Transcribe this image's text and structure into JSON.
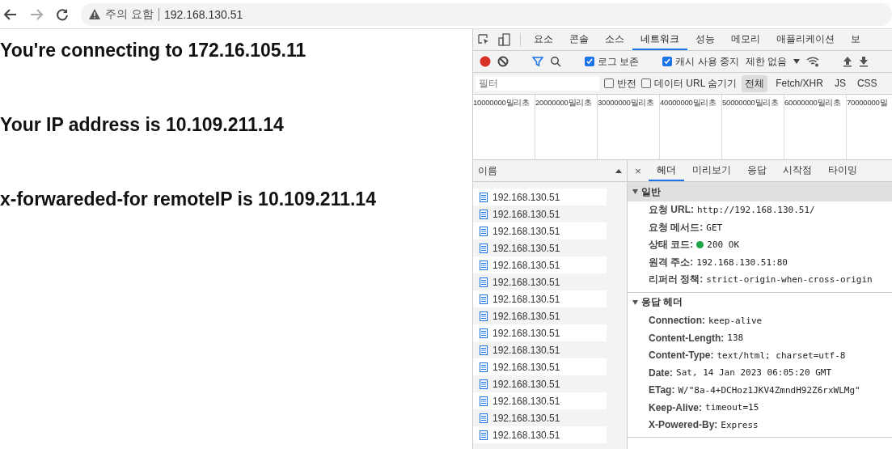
{
  "browser": {
    "warning": "주의 요함",
    "url": "192.168.130.51"
  },
  "page": {
    "lines": [
      "You're connecting to 172.16.105.11",
      "Your IP address is 10.109.211.14",
      "x-forwareded-for remoteIP is 10.109.211.14"
    ]
  },
  "devtools": {
    "tabs": [
      {
        "label": "요소",
        "selected": false
      },
      {
        "label": "콘솔",
        "selected": false
      },
      {
        "label": "소스",
        "selected": false
      },
      {
        "label": "네트워크",
        "selected": true
      },
      {
        "label": "성능",
        "selected": false
      },
      {
        "label": "메모리",
        "selected": false
      },
      {
        "label": "애플리케이션",
        "selected": false
      },
      {
        "label": "보",
        "selected": false
      }
    ],
    "toolbar": {
      "recording": true,
      "preserve_log": {
        "label": "로그 보존",
        "checked": true
      },
      "disable_cache": {
        "label": "캐시 사용 중지",
        "checked": true
      },
      "throttling": "제한 없음"
    },
    "filter": {
      "placeholder": "필터",
      "invert": {
        "label": "반전",
        "checked": false
      },
      "hide_data_urls": {
        "label": "데이터 URL 숨기기",
        "checked": false
      },
      "types": [
        {
          "label": "전체",
          "selected": true
        },
        {
          "label": "Fetch/XHR",
          "selected": false
        },
        {
          "label": "JS",
          "selected": false
        },
        {
          "label": "CSS",
          "selected": false
        }
      ]
    },
    "timeline": [
      "10000000밀리초",
      "20000000밀리초",
      "30000000밀리초",
      "40000000밀리초",
      "50000000밀리초",
      "60000000밀리초",
      "70000000밀"
    ],
    "requests": {
      "header": "이름",
      "rows": [
        "192.168.130.51",
        "192.168.130.51",
        "192.168.130.51",
        "192.168.130.51",
        "192.168.130.51",
        "192.168.130.51",
        "192.168.130.51",
        "192.168.130.51",
        "192.168.130.51",
        "192.168.130.51",
        "192.168.130.51",
        "192.168.130.51",
        "192.168.130.51",
        "192.168.130.51",
        "192.168.130.51"
      ]
    },
    "detail": {
      "close": "×",
      "tabs": [
        {
          "label": "헤더",
          "selected": true
        },
        {
          "label": "미리보기",
          "selected": false
        },
        {
          "label": "응답",
          "selected": false
        },
        {
          "label": "시작점",
          "selected": false
        },
        {
          "label": "타이밍",
          "selected": false
        }
      ],
      "sections": [
        {
          "title": "일반",
          "expanded": true,
          "highlighted": true,
          "rows": [
            {
              "key": "요청 URL:",
              "value": "http://192.168.130.51/"
            },
            {
              "key": "요청 메서드:",
              "value": "GET"
            },
            {
              "key": "상태 코드:",
              "value": "200 OK",
              "color": "#1ea446"
            },
            {
              "key": "원격 주소:",
              "value": "192.168.130.51:80"
            },
            {
              "key": "리퍼러 정책:",
              "value": "strict-origin-when-cross-origin"
            }
          ]
        },
        {
          "title": "응답 헤더",
          "expanded": true,
          "highlighted": false,
          "rows": [
            {
              "key": "Connection:",
              "value": "keep-alive"
            },
            {
              "key": "Content-Length:",
              "value": "138"
            },
            {
              "key": "Content-Type:",
              "value": "text/html; charset=utf-8"
            },
            {
              "key": "Date:",
              "value": "Sat, 14 Jan 2023 06:05:20 GMT"
            },
            {
              "key": "ETag:",
              "value": "W/\"8a-4+DCHoz1JKV4ZmndH92Z6rxWLMg\""
            },
            {
              "key": "Keep-Alive:",
              "value": "timeout=15"
            },
            {
              "key": "X-Powered-By:",
              "value": "Express"
            }
          ]
        }
      ]
    }
  }
}
